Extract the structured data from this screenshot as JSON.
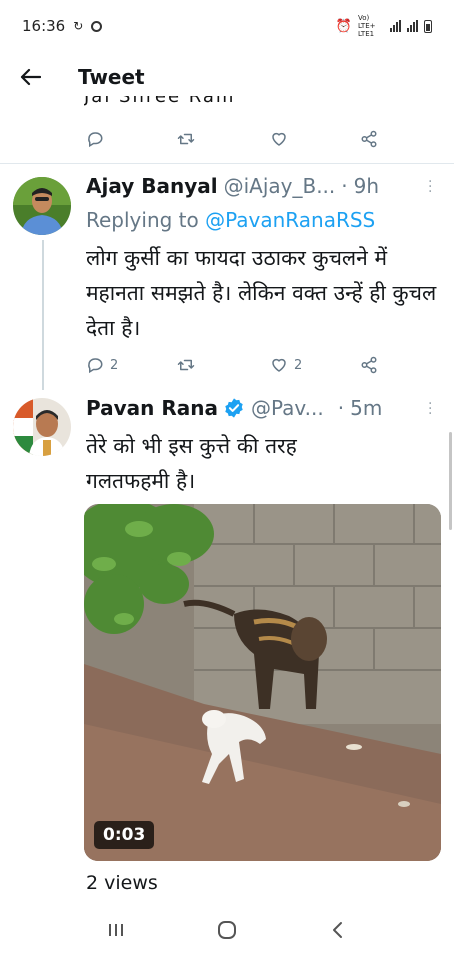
{
  "status_bar": {
    "time": "16:36",
    "network": "Vo) LTE+ LTE1"
  },
  "app_bar": {
    "title": "Tweet"
  },
  "previous_tweet": {
    "tail_text": "Jai Shree Ram"
  },
  "reply_tweet": {
    "display_name": "Ajay Banyal",
    "handle": "@iAjay_B...",
    "separator": "·",
    "time": "9h",
    "replying_prefix": "Replying to",
    "replying_to": "@PavanRanaRSS",
    "text": "लोग कुर्सी का फायदा उठाकर कुचलने में महानता समझते है। लेकिन वक्त उन्हें ही कुचल देता है।",
    "reply_count": "2",
    "like_count": "2"
  },
  "main_tweet": {
    "display_name": "Pavan Rana",
    "handle": "@Pav...",
    "separator": "·",
    "time": "5m",
    "text": "तेरे को भी इस कुत्ते की तरह गलतफहमी है।",
    "video_duration": "0:03",
    "views": "2 views"
  },
  "colors": {
    "accent": "#1da1f2",
    "secondary_text": "#657786",
    "divider": "#e1e8ed",
    "verified": "#1da1f2"
  },
  "icons": [
    "back-arrow-icon",
    "reply-icon",
    "retweet-icon",
    "like-icon",
    "share-icon",
    "more-icon",
    "verified-icon",
    "recents-icon",
    "home-icon",
    "back-nav-icon"
  ]
}
